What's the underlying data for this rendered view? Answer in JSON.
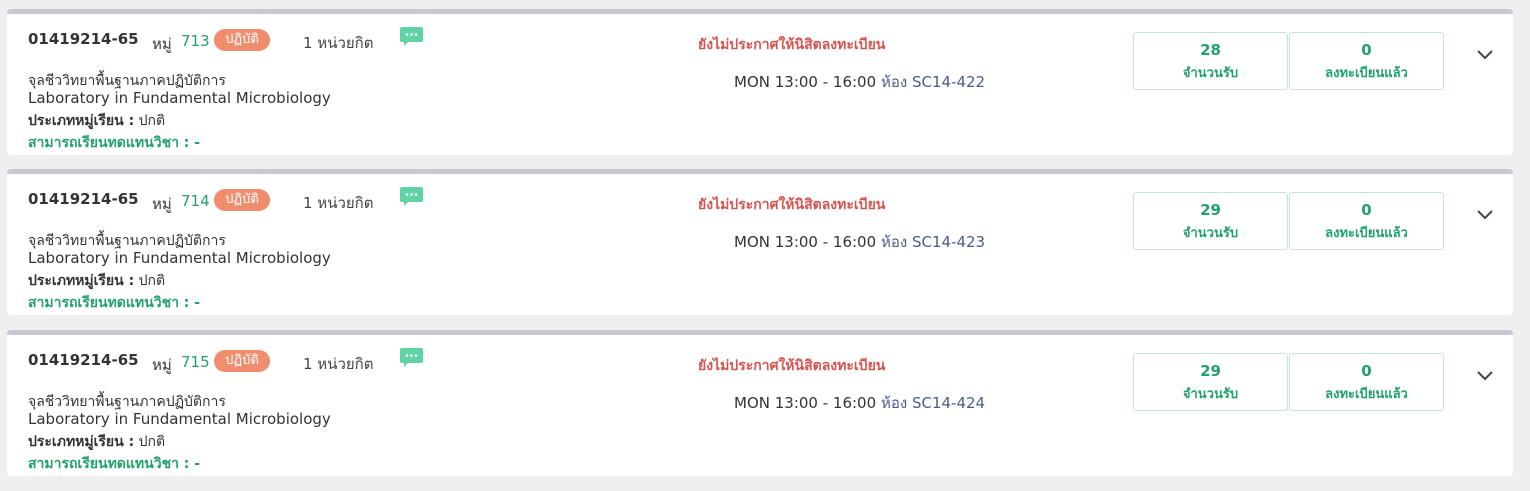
{
  "sections": [
    {
      "course_code": "01419214-65",
      "section_label": "หมู่",
      "section_number": "713",
      "section_type": "ปฏิบัติ",
      "credits": "1 หน่วยกิต",
      "course_name_th": "จุลชีววิทยาพื้นฐานภาคปฏิบัติการ",
      "course_name_en": "Laboratory in Fundamental Microbiology",
      "group_type_label": "ประเภทหมู่เรียน :",
      "group_type_value": "ปกติ",
      "substitute_label": "สามารถเรียนทดแทนวิชา : -",
      "status": "ยังไม่ประกาศให้นิสิตลงทะเบียน",
      "schedule_time": "MON 13:00 - 16:00",
      "room_label": "ห้อง",
      "room": "SC14-422",
      "capacity": "28",
      "capacity_label": "จำนวนรับ",
      "registered": "0",
      "registered_label": "ลงทะเบียนแล้ว",
      "icons": {
        "note": "chat-bubble-icon",
        "expand": "chevron-down-icon"
      }
    },
    {
      "course_code": "01419214-65",
      "section_label": "หมู่",
      "section_number": "714",
      "section_type": "ปฏิบัติ",
      "credits": "1 หน่วยกิต",
      "course_name_th": "จุลชีววิทยาพื้นฐานภาคปฏิบัติการ",
      "course_name_en": "Laboratory in Fundamental Microbiology",
      "group_type_label": "ประเภทหมู่เรียน :",
      "group_type_value": "ปกติ",
      "substitute_label": "สามารถเรียนทดแทนวิชา : -",
      "status": "ยังไม่ประกาศให้นิสิตลงทะเบียน",
      "schedule_time": "MON 13:00 - 16:00",
      "room_label": "ห้อง",
      "room": "SC14-423",
      "capacity": "29",
      "capacity_label": "จำนวนรับ",
      "registered": "0",
      "registered_label": "ลงทะเบียนแล้ว",
      "icons": {
        "note": "chat-bubble-icon",
        "expand": "chevron-down-icon"
      }
    },
    {
      "course_code": "01419214-65",
      "section_label": "หมู่",
      "section_number": "715",
      "section_type": "ปฏิบัติ",
      "credits": "1 หน่วยกิต",
      "course_name_th": "จุลชีววิทยาพื้นฐานภาคปฏิบัติการ",
      "course_name_en": "Laboratory in Fundamental Microbiology",
      "group_type_label": "ประเภทหมู่เรียน :",
      "group_type_value": "ปกติ",
      "substitute_label": "สามารถเรียนทดแทนวิชา : -",
      "status": "ยังไม่ประกาศให้นิสิตลงทะเบียน",
      "schedule_time": "MON 13:00 - 16:00",
      "room_label": "ห้อง",
      "room": "SC14-424",
      "capacity": "29",
      "capacity_label": "จำนวนรับ",
      "registered": "0",
      "registered_label": "ลงทะเบียนแล้ว",
      "icons": {
        "note": "chat-bubble-icon",
        "expand": "chevron-down-icon"
      }
    }
  ],
  "colors": {
    "accent_green": "#1fa36a",
    "status_red": "#d9534f",
    "badge_orange": "#ef8d6c",
    "room_blue": "#4a5a8f"
  }
}
